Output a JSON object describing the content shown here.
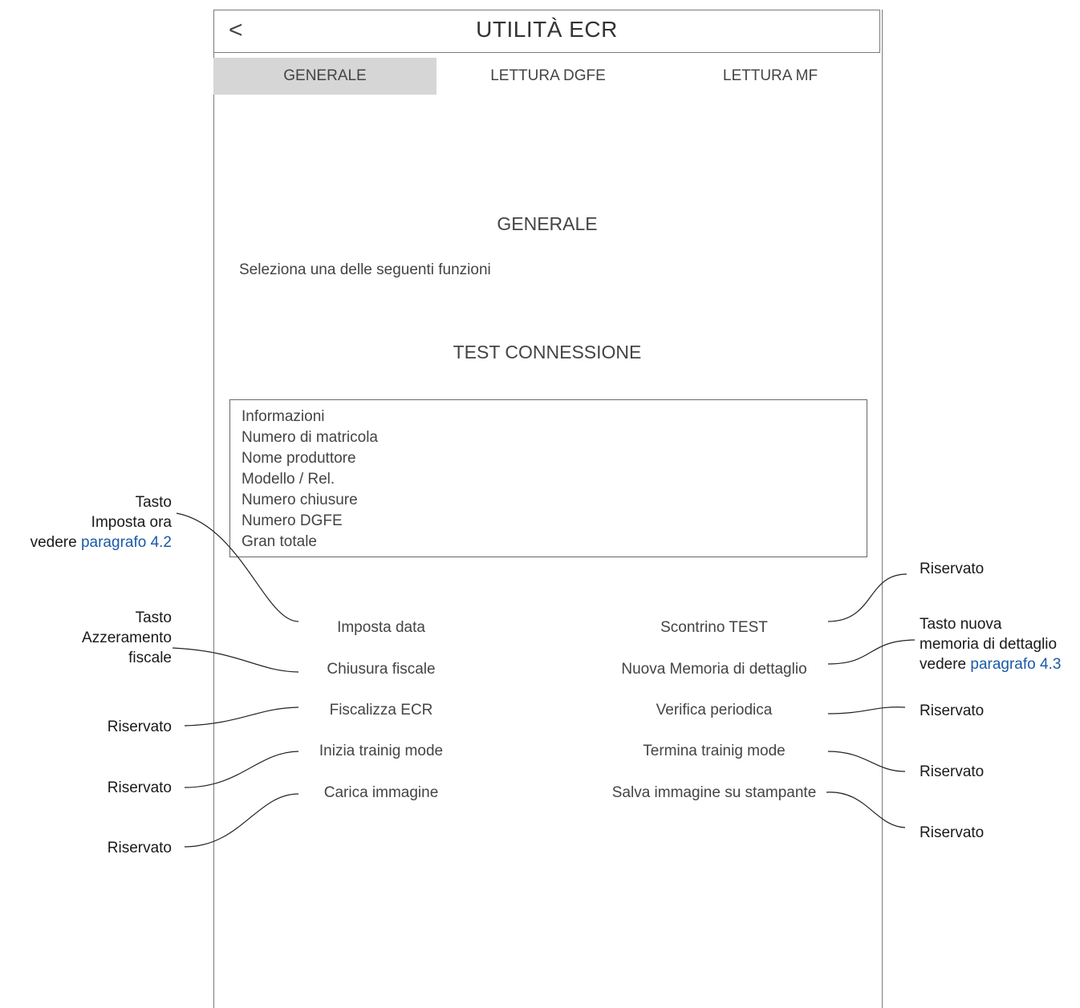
{
  "header": {
    "back_label": "<",
    "title": "UTILITÀ ECR"
  },
  "tabs": [
    "GENERALE",
    "LETTURA DGFE",
    "LETTURA MF"
  ],
  "active_tab": "GENERALE",
  "main": {
    "section_title": "GENERALE",
    "instruction": "Seleziona una delle seguenti funzioni",
    "test_button": "TEST CONNESSIONE",
    "info": {
      "header": "Informazioni",
      "lines": [
        "Numero di matricola",
        "Nome produttore",
        "Modello / Rel.",
        "Numero chiusure",
        "Numero DGFE",
        "Gran totale"
      ]
    }
  },
  "functions": {
    "left": [
      "Imposta data",
      "Chiusura fiscale",
      "Fiscalizza ECR",
      "Inizia trainig mode",
      "Carica immagine"
    ],
    "right": [
      "Scontrino TEST",
      "Nuova Memoria di dettaglio",
      "Verifica periodica",
      "Termina trainig mode",
      "Salva immagine su stampante"
    ]
  },
  "annotations": {
    "left": [
      {
        "lines": [
          "Tasto",
          "Imposta ora"
        ],
        "prefix": "vedere ",
        "link": "paragrafo 4.2"
      },
      {
        "lines": [
          "Tasto",
          "Azzeramento",
          "fiscale"
        ]
      },
      {
        "lines": [
          "Riservato"
        ]
      },
      {
        "lines": [
          "Riservato"
        ]
      },
      {
        "lines": [
          "Riservato"
        ]
      }
    ],
    "right": [
      {
        "lines": [
          "Riservato"
        ]
      },
      {
        "lines": [
          "Tasto  nuova",
          "memoria di dettaglio"
        ],
        "prefix": "vedere ",
        "link": "paragrafo 4.3"
      },
      {
        "lines": [
          "Riservato"
        ]
      },
      {
        "lines": [
          "Riservato"
        ]
      },
      {
        "lines": [
          "Riservato"
        ]
      }
    ]
  },
  "colors": {
    "link": "#1a5aa8",
    "active_tab_bg": "#d6d6d6",
    "border": "#7a7a7a"
  }
}
